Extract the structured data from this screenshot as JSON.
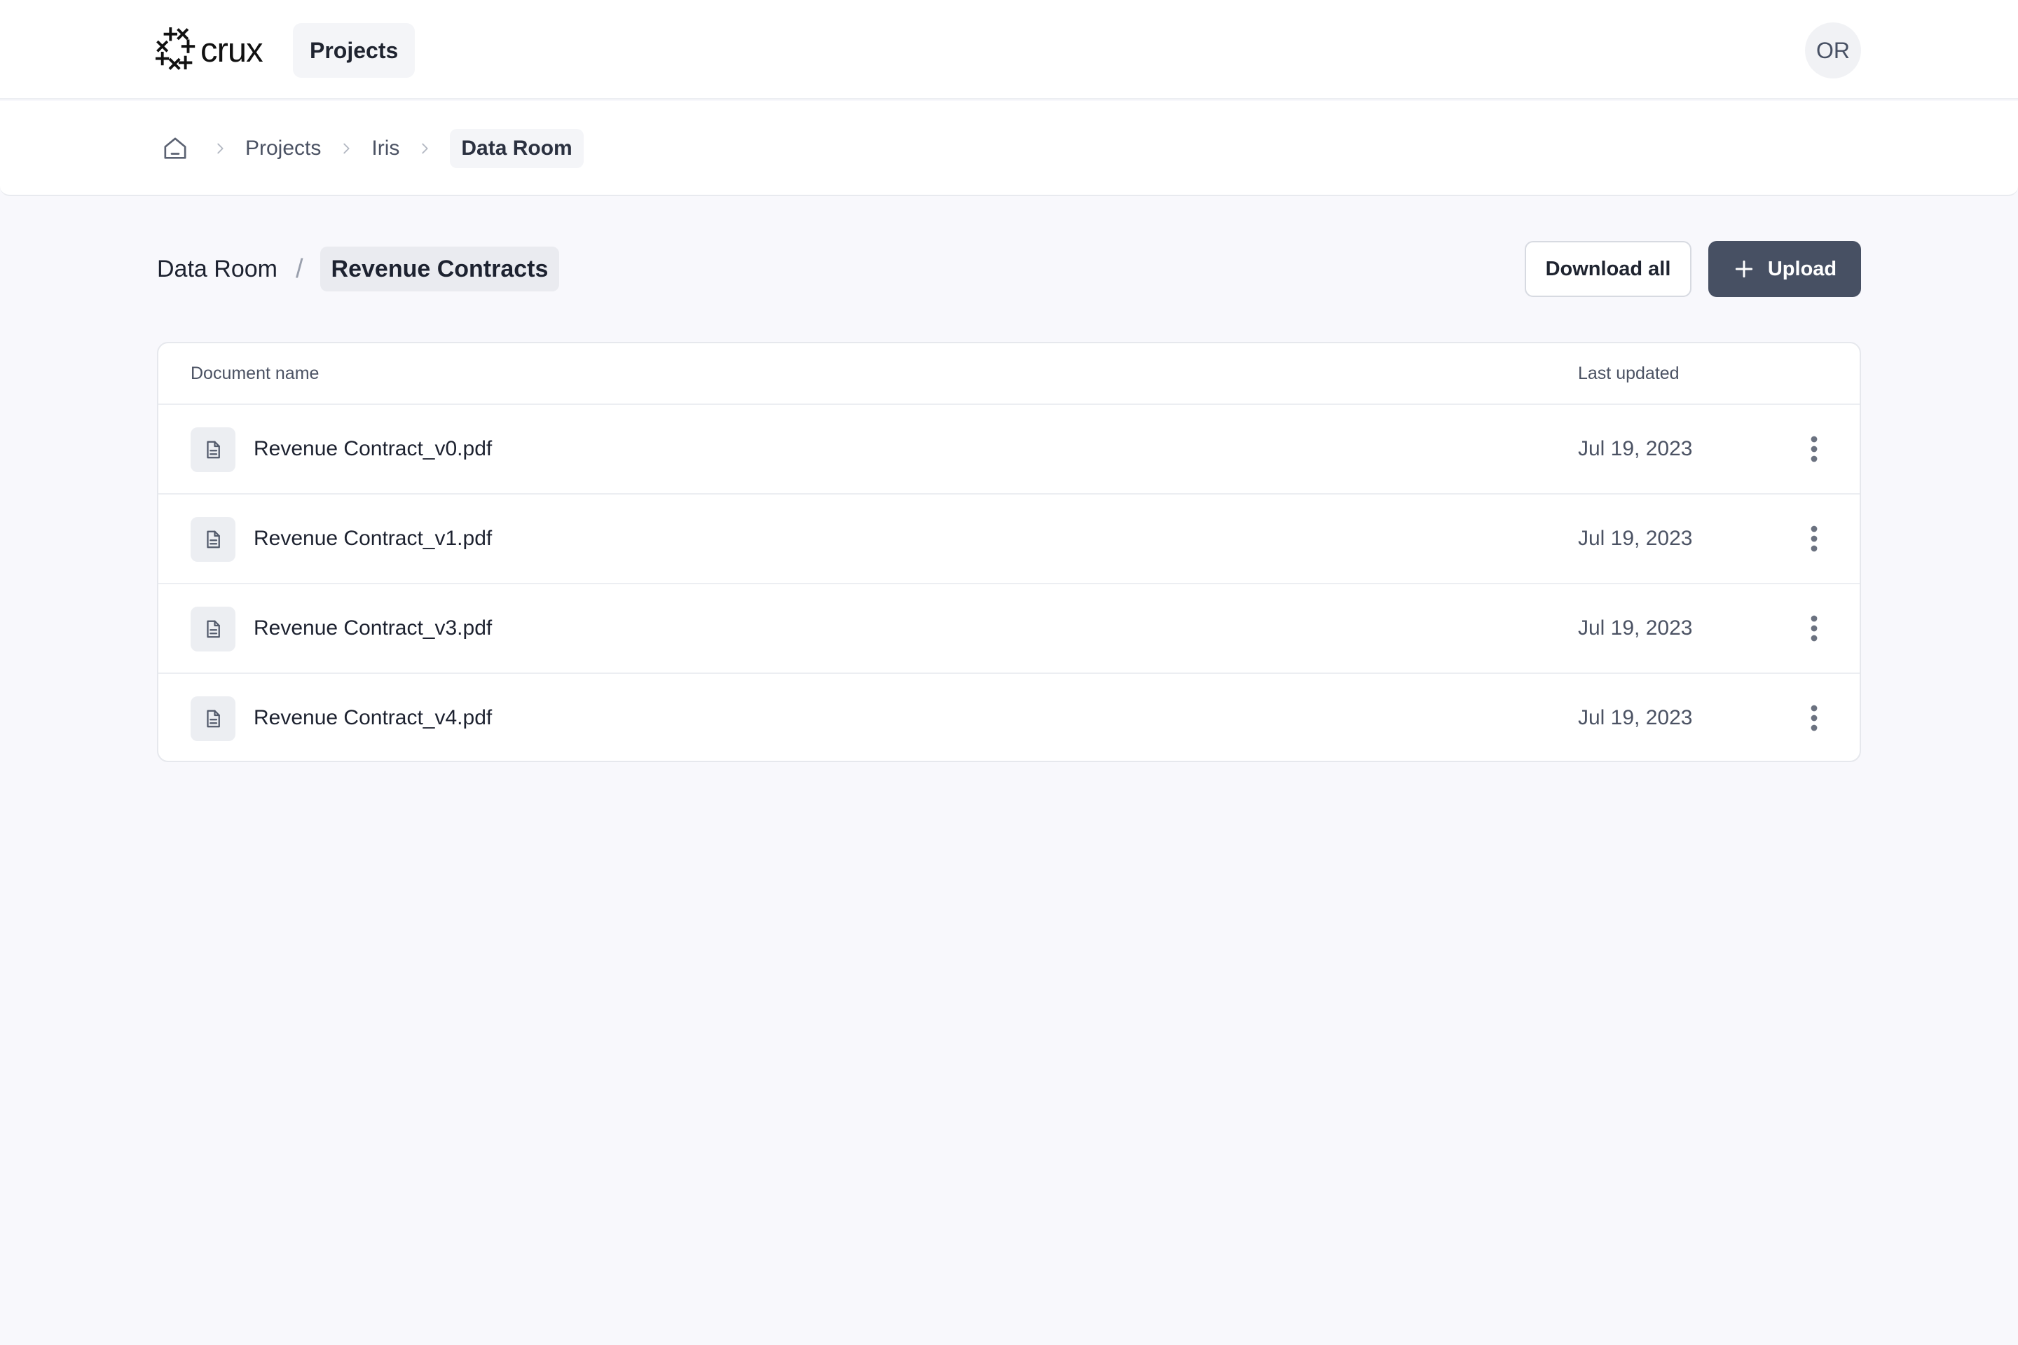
{
  "header": {
    "logo_text": "crux",
    "nav_projects": "Projects",
    "avatar_initials": "OR"
  },
  "breadcrumb": {
    "items": [
      "Projects",
      "Iris"
    ],
    "current": "Data Room"
  },
  "page": {
    "parent": "Data Room",
    "separator": "/",
    "current": "Revenue Contracts",
    "download_all_label": "Download all",
    "upload_label": "Upload"
  },
  "table": {
    "columns": [
      "Document name",
      "Last updated"
    ],
    "rows": [
      {
        "name": "Revenue Contract_v0.pdf",
        "updated": "Jul 19, 2023"
      },
      {
        "name": "Revenue Contract_v1.pdf",
        "updated": "Jul 19, 2023"
      },
      {
        "name": "Revenue Contract_v3.pdf",
        "updated": "Jul 19, 2023"
      },
      {
        "name": "Revenue Contract_v4.pdf",
        "updated": "Jul 19, 2023"
      }
    ]
  },
  "icons": {
    "logo": "crux-asterisk-logo-icon",
    "home": "home-icon",
    "separator": "chevron-right-icon",
    "upload": "plus-icon",
    "file": "document-icon",
    "row_menu": "more-vertical-icon"
  },
  "colors": {
    "page_background": "#f8f8fc",
    "primary_button": "#475063",
    "text_primary": "#1d2230",
    "text_secondary": "#4b5263"
  }
}
